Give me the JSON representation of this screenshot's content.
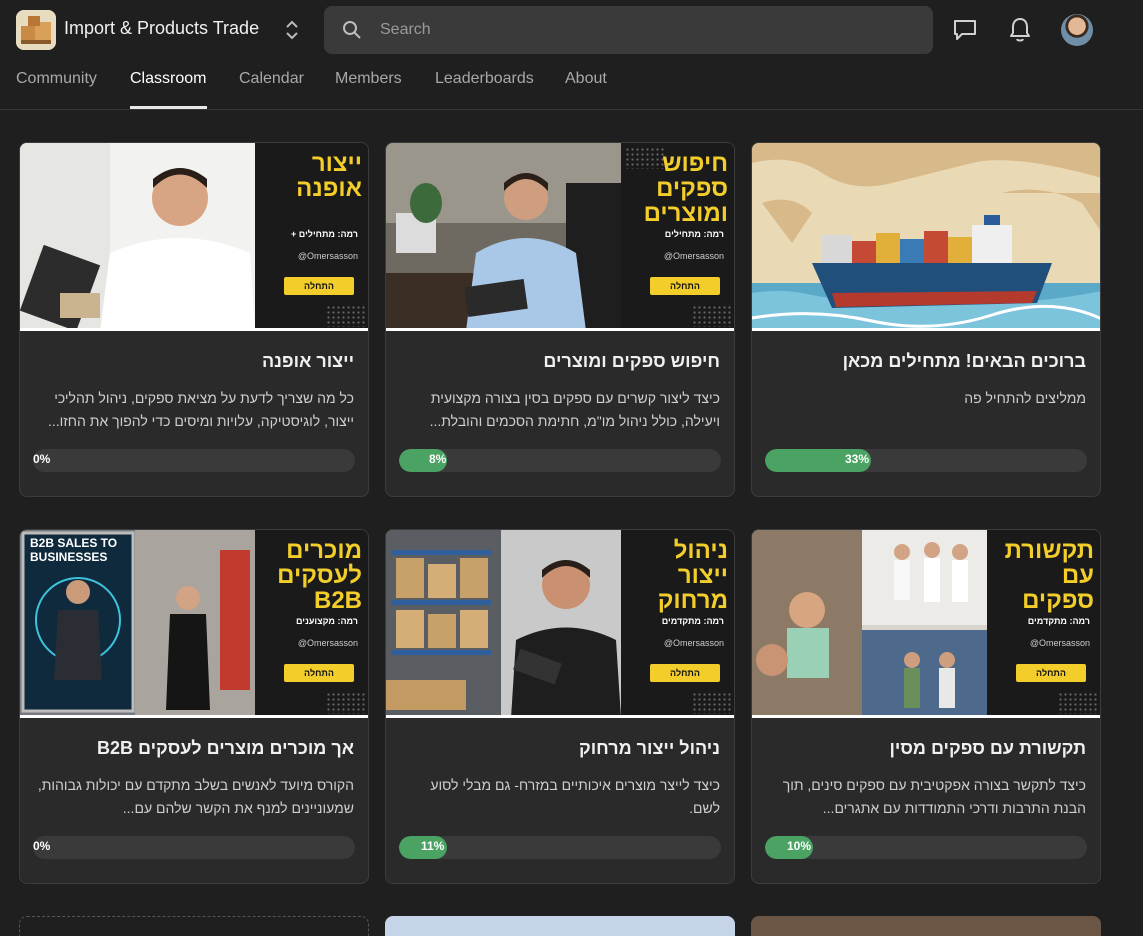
{
  "header": {
    "app_title": "Import & Products Trade",
    "search_placeholder": "Search",
    "icons": {
      "logo": "boxes-logo-icon",
      "switcher": "chevron-up-down-icon",
      "search": "search-icon",
      "chat": "chat-icon",
      "notifications": "bell-icon"
    }
  },
  "tabs": [
    {
      "label": "Community"
    },
    {
      "label": "Classroom",
      "active": true
    },
    {
      "label": "Calendar"
    },
    {
      "label": "Members"
    },
    {
      "label": "Leaderboards"
    },
    {
      "label": "About"
    }
  ],
  "courses": [
    {
      "title": "ברוכים הבאים! מתחילים מכאן",
      "description": "ממליצים להתחיל פה",
      "progress": 33,
      "progress_label": "33%",
      "cover": {
        "type": "ship-map"
      }
    },
    {
      "title": "חיפוש ספקים ומוצרים",
      "description": "כיצד ליצור קשרים עם ספקים בסין בצורה מקצועית ויעילה, כולל ניהול מו\"מ, חתימת הסכמים והובלת...",
      "progress": 8,
      "progress_label": "8%",
      "cover": {
        "title": "חיפוש ספקים ומוצרים",
        "level": "רמה: מתחילים",
        "handle": "@Omersasson",
        "button": "התחלה"
      }
    },
    {
      "title": "ייצור אופנה",
      "description": "כל מה שצריך לדעת על מציאת ספקים, ניהול תהליכי ייצור, לוגיסטיקה, עלויות ומיסים כדי להפוך את החזו...",
      "progress": 0,
      "progress_label": "0%",
      "cover": {
        "title": "ייצור אופנה",
        "level": "רמה: מתחילים +",
        "handle": "@Omersasson",
        "button": "התחלה"
      }
    },
    {
      "title": "תקשורת עם ספקים מסין",
      "description": "כיצד לתקשר בצורה אפקטיבית עם ספקים סינים, תוך הבנת התרבות ודרכי התמודדות עם אתגרים...",
      "progress": 10,
      "progress_label": "10%",
      "cover": {
        "title": "תקשורת עם ספקים",
        "level": "רמה: מתקדמים",
        "handle": "@Omersasson",
        "button": "התחלה"
      }
    },
    {
      "title": "ניהול ייצור מרחוק",
      "description": "כיצד לייצר מוצרים איכותיים במזרח- גם מבלי לסוע לשם.",
      "progress": 11,
      "progress_label": "11%",
      "cover": {
        "title": "ניהול ייצור מרחוק",
        "level": "רמה: מתקדמים",
        "handle": "@Omersasson",
        "button": "התחלה"
      }
    },
    {
      "title": "אך מוכרים מוצרים לעסקים B2B",
      "description": "הקורס מיועד לאנשים בשלב מתקדם עם יכולות גבוהות, שמעוניינים למנף את הקשר שלהם עם...",
      "progress": 0,
      "progress_label": "0%",
      "cover": {
        "title": "מוכרים לעסקים B2B",
        "level": "רמה: מקצוענים",
        "handle": "@Omersasson",
        "button": "התחלה",
        "poster_text": "B2B SALES TO BUSINESSES"
      }
    }
  ],
  "colors": {
    "background": "#1f1f1f",
    "card": "#2a2a2a",
    "accent_yellow": "#f3cd2a",
    "progress_green": "#4aa362",
    "progress_track": "#3a3a3a"
  }
}
